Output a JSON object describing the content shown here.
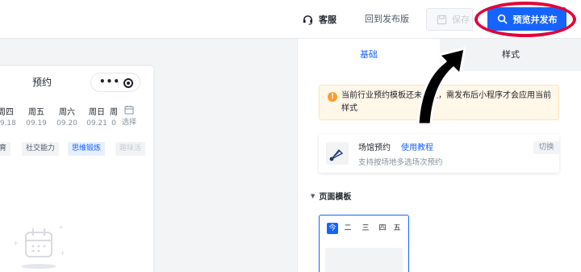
{
  "topbar": {
    "customer_service": "客服",
    "revert": "回到发布版",
    "save": "保存",
    "preview_publish": "预览并发布"
  },
  "phone": {
    "title": "预约",
    "capsule_dots": "•••",
    "days": [
      {
        "name": "周四",
        "date": "09.18"
      },
      {
        "name": "周五",
        "date": "09.19"
      },
      {
        "name": "周六",
        "date": "09.20"
      },
      {
        "name": "周日",
        "date": "09.21"
      },
      {
        "name": "周",
        "date": "0"
      }
    ],
    "select_label": "选择",
    "categories": [
      "育",
      "社交能力",
      "思维锻炼",
      "趣味活"
    ]
  },
  "panel": {
    "tabs": [
      "基础",
      "样式"
    ],
    "notice": "当前行业预约模板还未生效，需发布后小程序才会应用当前样式",
    "venue": {
      "name": "场馆预约",
      "link": "使用教程",
      "desc": "支持按场地多选场次预约",
      "switch": "切换"
    },
    "section_title": "页面模板",
    "template_weekdays": [
      "今",
      "二",
      "三",
      "四",
      "五"
    ]
  },
  "colors": {
    "primary": "#1664ff",
    "highlight_ring": "#e3003a",
    "notice_bg": "#fff7e8",
    "warning": "#ff9a2e"
  }
}
